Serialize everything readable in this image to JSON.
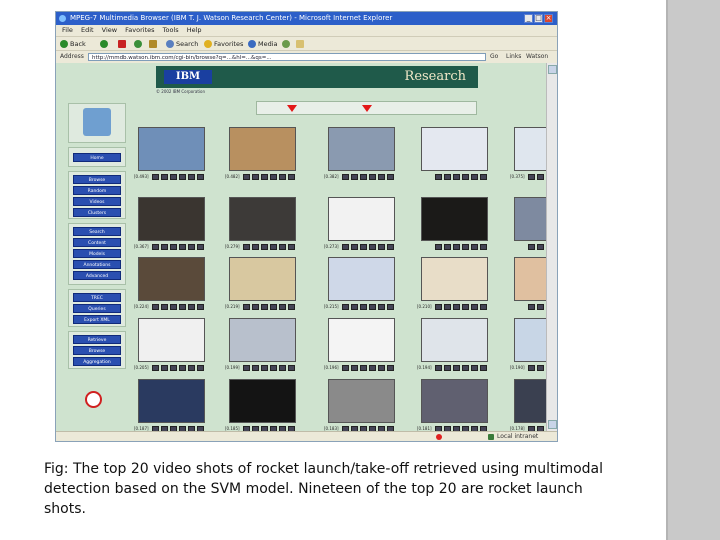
{
  "window": {
    "title": "MPEG-7 Multimedia Browser (IBM T. J. Watson Research Center) - Microsoft Internet Explorer",
    "close_glyph": "×"
  },
  "menu": [
    "File",
    "Edit",
    "View",
    "Favorites",
    "Tools",
    "Help"
  ],
  "toolbar": {
    "back": "Back",
    "search": "Search",
    "favorites": "Favorites",
    "media": "Media"
  },
  "address": {
    "label": "Address",
    "url": "http://mmdb.watson.ibm.com/cgi-bin/browse?q=...&hl=...&qs=...",
    "go": "Go",
    "links": "Links",
    "watson": "Watson"
  },
  "banner": {
    "ibm": "IBM",
    "research": "Research",
    "copyright": "© 2002 IBM Corporation"
  },
  "nav": [
    "Home",
    "Browse",
    "Random",
    "Videos",
    "Clusters",
    "Search",
    "Content",
    "Models",
    "Annotations",
    "Advanced",
    "TREC",
    "Queries",
    "Export XML",
    "Retrieve",
    "Browse",
    "Aggregation"
  ],
  "thumb_labels": [
    "[0.493]",
    "[0.482]",
    "[0.382]",
    "",
    "[0.375]",
    "[0.367]",
    "[0.279]",
    "[0.273]",
    "",
    "",
    "[0.224]",
    "[0.219]",
    "[0.215]",
    "[0.210]",
    "",
    "[0.205]",
    "[0.199]",
    "[0.196]",
    "[0.194]",
    "[0.190]",
    "[0.187]",
    "[0.185]",
    "[0.183]",
    "[0.181]",
    "[0.178]"
  ],
  "status": {
    "zone": "Local intranet"
  },
  "caption": "Fig: The top 20 video shots of rocket launch/take-off retrieved using multimodal detection based on the SVM model. Nineteen of the top 20 are rocket launch shots.",
  "colors": {
    "titlebar": "#2c5fc9",
    "content_bg": "#cfe3cf",
    "nav_button": "#2a4fb0",
    "banner": "#1f5a4a"
  }
}
